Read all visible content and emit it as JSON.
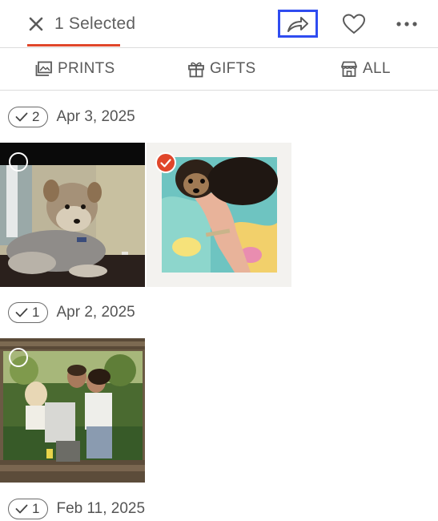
{
  "header": {
    "selected_label": "1 Selected",
    "icons": {
      "close": "close-icon",
      "share": "share-icon",
      "favorite": "heart-icon",
      "more": "more-icon"
    },
    "accent_color": "#e0462a",
    "focus_color": "#2f4cf0"
  },
  "categories": [
    {
      "label": "PRINTS",
      "icon": "prints-icon"
    },
    {
      "label": "GIFTS",
      "icon": "gift-icon"
    },
    {
      "label": "ALL",
      "icon": "store-icon"
    }
  ],
  "groups": [
    {
      "count": "2",
      "date": "Apr 3, 2025",
      "photos": [
        {
          "subject": "yorkie dog lying on couch",
          "selected": false
        },
        {
          "subject": "yorkie puppy held in hand",
          "selected": true
        }
      ]
    },
    {
      "count": "1",
      "date": "Apr 2, 2025",
      "photos": [
        {
          "subject": "family kissing outdoors with baby",
          "selected": false
        }
      ]
    },
    {
      "count": "1",
      "date": "Feb 11, 2025",
      "photos": []
    }
  ]
}
